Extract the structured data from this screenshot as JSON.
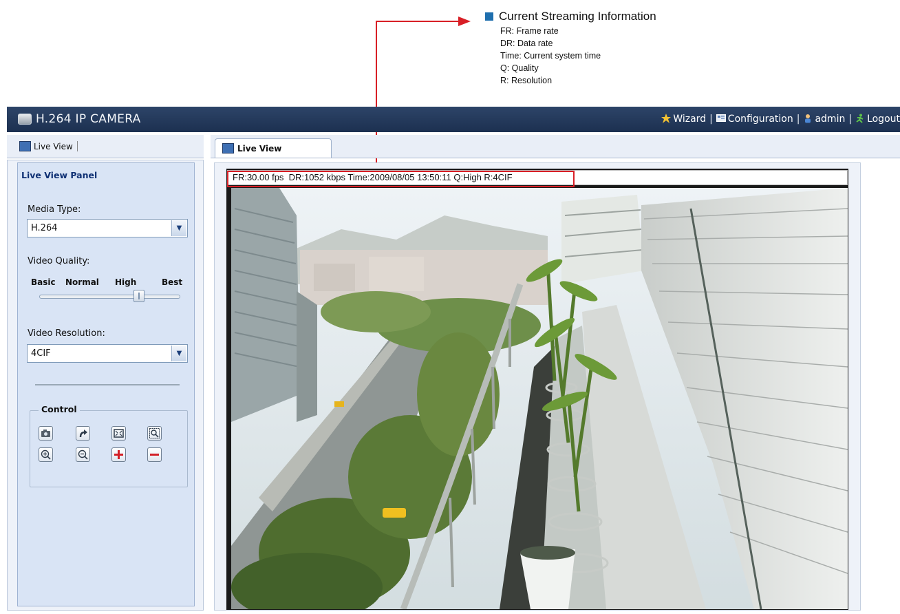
{
  "callout": {
    "title": "Current Streaming Information",
    "items": [
      "FR: Frame rate",
      "DR: Data rate",
      "Time: Current system time",
      "Q: Quality",
      "R: Resolution"
    ]
  },
  "header": {
    "app_title": "H.264 IP CAMERA",
    "links": [
      "Wizard",
      "Configuration",
      "admin",
      "Logout"
    ]
  },
  "left_tab": {
    "label": "Live View"
  },
  "main_tab": {
    "label": "Live View"
  },
  "panel": {
    "title": "Live View Panel",
    "media_type_label": "Media Type:",
    "media_type_value": "H.264",
    "video_quality_label": "Video Quality:",
    "quality_levels": [
      "Basic",
      "Normal",
      "High",
      "Best"
    ],
    "quality_selected": "High",
    "video_resolution_label": "Video Resolution:",
    "video_resolution_value": "4CIF",
    "control_label": "Control"
  },
  "stream_info": "FR:30.00 fps  DR:1052 kbps Time:2009/08/05 13:50:11 Q:High R:4CIF",
  "colors": {
    "header_bg": "#24395a",
    "accent_red": "#d81f26",
    "callout_square": "#1f6fae"
  },
  "control_icons": [
    "snapshot-icon",
    "rotate-icon",
    "fullscreen-icon",
    "digital-zoom-icon",
    "zoom-in-icon",
    "zoom-out-icon",
    "plus-icon",
    "minus-icon"
  ]
}
